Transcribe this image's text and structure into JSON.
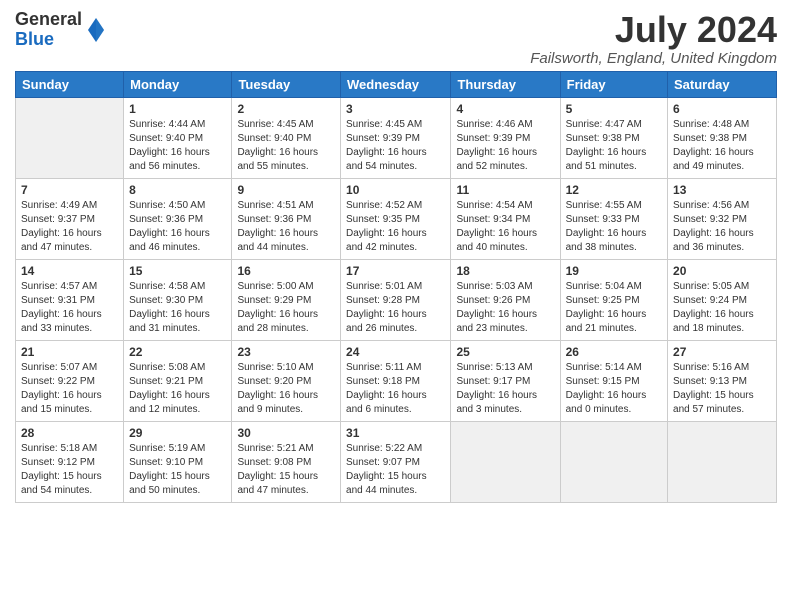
{
  "header": {
    "logo_general": "General",
    "logo_blue": "Blue",
    "month_year": "July 2024",
    "location": "Failsworth, England, United Kingdom"
  },
  "days_of_week": [
    "Sunday",
    "Monday",
    "Tuesday",
    "Wednesday",
    "Thursday",
    "Friday",
    "Saturday"
  ],
  "weeks": [
    [
      {
        "day": "",
        "info": ""
      },
      {
        "day": "1",
        "info": "Sunrise: 4:44 AM\nSunset: 9:40 PM\nDaylight: 16 hours\nand 56 minutes."
      },
      {
        "day": "2",
        "info": "Sunrise: 4:45 AM\nSunset: 9:40 PM\nDaylight: 16 hours\nand 55 minutes."
      },
      {
        "day": "3",
        "info": "Sunrise: 4:45 AM\nSunset: 9:39 PM\nDaylight: 16 hours\nand 54 minutes."
      },
      {
        "day": "4",
        "info": "Sunrise: 4:46 AM\nSunset: 9:39 PM\nDaylight: 16 hours\nand 52 minutes."
      },
      {
        "day": "5",
        "info": "Sunrise: 4:47 AM\nSunset: 9:38 PM\nDaylight: 16 hours\nand 51 minutes."
      },
      {
        "day": "6",
        "info": "Sunrise: 4:48 AM\nSunset: 9:38 PM\nDaylight: 16 hours\nand 49 minutes."
      }
    ],
    [
      {
        "day": "7",
        "info": "Sunrise: 4:49 AM\nSunset: 9:37 PM\nDaylight: 16 hours\nand 47 minutes."
      },
      {
        "day": "8",
        "info": "Sunrise: 4:50 AM\nSunset: 9:36 PM\nDaylight: 16 hours\nand 46 minutes."
      },
      {
        "day": "9",
        "info": "Sunrise: 4:51 AM\nSunset: 9:36 PM\nDaylight: 16 hours\nand 44 minutes."
      },
      {
        "day": "10",
        "info": "Sunrise: 4:52 AM\nSunset: 9:35 PM\nDaylight: 16 hours\nand 42 minutes."
      },
      {
        "day": "11",
        "info": "Sunrise: 4:54 AM\nSunset: 9:34 PM\nDaylight: 16 hours\nand 40 minutes."
      },
      {
        "day": "12",
        "info": "Sunrise: 4:55 AM\nSunset: 9:33 PM\nDaylight: 16 hours\nand 38 minutes."
      },
      {
        "day": "13",
        "info": "Sunrise: 4:56 AM\nSunset: 9:32 PM\nDaylight: 16 hours\nand 36 minutes."
      }
    ],
    [
      {
        "day": "14",
        "info": "Sunrise: 4:57 AM\nSunset: 9:31 PM\nDaylight: 16 hours\nand 33 minutes."
      },
      {
        "day": "15",
        "info": "Sunrise: 4:58 AM\nSunset: 9:30 PM\nDaylight: 16 hours\nand 31 minutes."
      },
      {
        "day": "16",
        "info": "Sunrise: 5:00 AM\nSunset: 9:29 PM\nDaylight: 16 hours\nand 28 minutes."
      },
      {
        "day": "17",
        "info": "Sunrise: 5:01 AM\nSunset: 9:28 PM\nDaylight: 16 hours\nand 26 minutes."
      },
      {
        "day": "18",
        "info": "Sunrise: 5:03 AM\nSunset: 9:26 PM\nDaylight: 16 hours\nand 23 minutes."
      },
      {
        "day": "19",
        "info": "Sunrise: 5:04 AM\nSunset: 9:25 PM\nDaylight: 16 hours\nand 21 minutes."
      },
      {
        "day": "20",
        "info": "Sunrise: 5:05 AM\nSunset: 9:24 PM\nDaylight: 16 hours\nand 18 minutes."
      }
    ],
    [
      {
        "day": "21",
        "info": "Sunrise: 5:07 AM\nSunset: 9:22 PM\nDaylight: 16 hours\nand 15 minutes."
      },
      {
        "day": "22",
        "info": "Sunrise: 5:08 AM\nSunset: 9:21 PM\nDaylight: 16 hours\nand 12 minutes."
      },
      {
        "day": "23",
        "info": "Sunrise: 5:10 AM\nSunset: 9:20 PM\nDaylight: 16 hours\nand 9 minutes."
      },
      {
        "day": "24",
        "info": "Sunrise: 5:11 AM\nSunset: 9:18 PM\nDaylight: 16 hours\nand 6 minutes."
      },
      {
        "day": "25",
        "info": "Sunrise: 5:13 AM\nSunset: 9:17 PM\nDaylight: 16 hours\nand 3 minutes."
      },
      {
        "day": "26",
        "info": "Sunrise: 5:14 AM\nSunset: 9:15 PM\nDaylight: 16 hours\nand 0 minutes."
      },
      {
        "day": "27",
        "info": "Sunrise: 5:16 AM\nSunset: 9:13 PM\nDaylight: 15 hours\nand 57 minutes."
      }
    ],
    [
      {
        "day": "28",
        "info": "Sunrise: 5:18 AM\nSunset: 9:12 PM\nDaylight: 15 hours\nand 54 minutes."
      },
      {
        "day": "29",
        "info": "Sunrise: 5:19 AM\nSunset: 9:10 PM\nDaylight: 15 hours\nand 50 minutes."
      },
      {
        "day": "30",
        "info": "Sunrise: 5:21 AM\nSunset: 9:08 PM\nDaylight: 15 hours\nand 47 minutes."
      },
      {
        "day": "31",
        "info": "Sunrise: 5:22 AM\nSunset: 9:07 PM\nDaylight: 15 hours\nand 44 minutes."
      },
      {
        "day": "",
        "info": ""
      },
      {
        "day": "",
        "info": ""
      },
      {
        "day": "",
        "info": ""
      }
    ]
  ]
}
